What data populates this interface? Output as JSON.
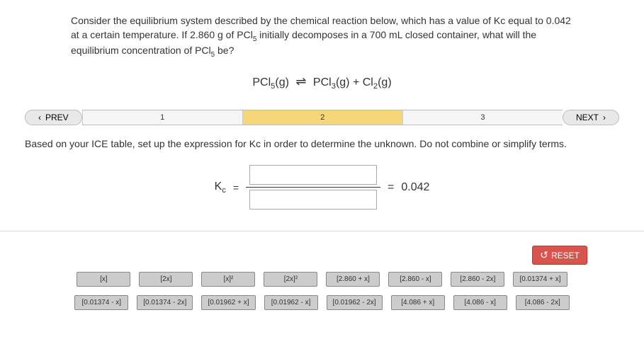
{
  "question": {
    "text_p1": "Consider the equilibrium system described by the chemical reaction below, which has a value of Kc equal to 0.042 at a certain temperature. If 2.860 g of PCl",
    "text_p2": " initially decomposes in a 700 mL closed container, what will the equilibrium concentration of PCl",
    "text_p3": " be?"
  },
  "reaction": {
    "left": "PCl",
    "left_sub": "5",
    "left_state": "(g)",
    "r1": "PCl",
    "r1_sub": "3",
    "r1_state": "(g)",
    "plus": "+",
    "r2": "Cl",
    "r2_sub": "2",
    "r2_state": "(g)"
  },
  "nav": {
    "prev": "PREV",
    "next": "NEXT",
    "step1": "1",
    "step2": "2",
    "step3": "3"
  },
  "instruction": "Based on your ICE table, set up the expression for Kc in order to determine the unknown. Do not combine or simplify terms.",
  "equation": {
    "kc_label": "K",
    "kc_sub": "c",
    "equals": "=",
    "result_eq": "=",
    "result_value": "0.042"
  },
  "reset": "RESET",
  "tiles_row1": [
    "[x]",
    "[2x]",
    "[x]²",
    "[2x]²",
    "[2.860 + x]",
    "[2.860 - x]",
    "[2.860 - 2x]",
    "[0.01374 + x]"
  ],
  "tiles_row2": [
    "[0.01374 - x]",
    "[0.01374 - 2x]",
    "[0.01962 + x]",
    "[0.01962 - x]",
    "[0.01962 - 2x]",
    "[4.086 + x]",
    "[4.086 - x]",
    "[4.086 - 2x]"
  ]
}
